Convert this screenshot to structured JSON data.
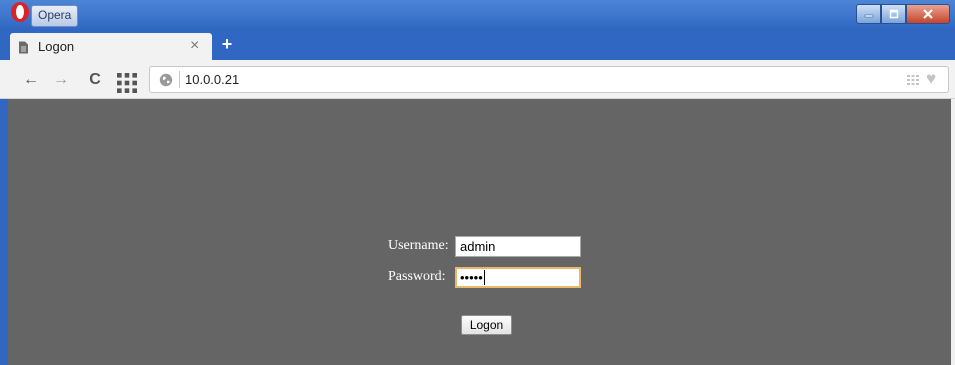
{
  "browser": {
    "menu_label": "Opera",
    "tab_title": "Logon",
    "tab_close_glyph": "×",
    "new_tab_glyph": "+",
    "address": "10.0.0.21"
  },
  "nav": {
    "back_glyph": "←",
    "forward_glyph": "→",
    "reload_glyph": "C"
  },
  "login": {
    "username_label": "Username:",
    "username_value": "admin",
    "password_label": "Password:",
    "password_value": "•••••",
    "submit_label": "Logon"
  },
  "icons": {
    "logo": "opera-logo-icon",
    "tab_page": "page-icon",
    "grid": "speed-dial-grid-icon",
    "globe": "globe-icon",
    "heart": "heart-icon"
  },
  "colors": {
    "titlebar": "#2f67c2",
    "page_background": "#656565",
    "close_button": "#c6452b"
  }
}
